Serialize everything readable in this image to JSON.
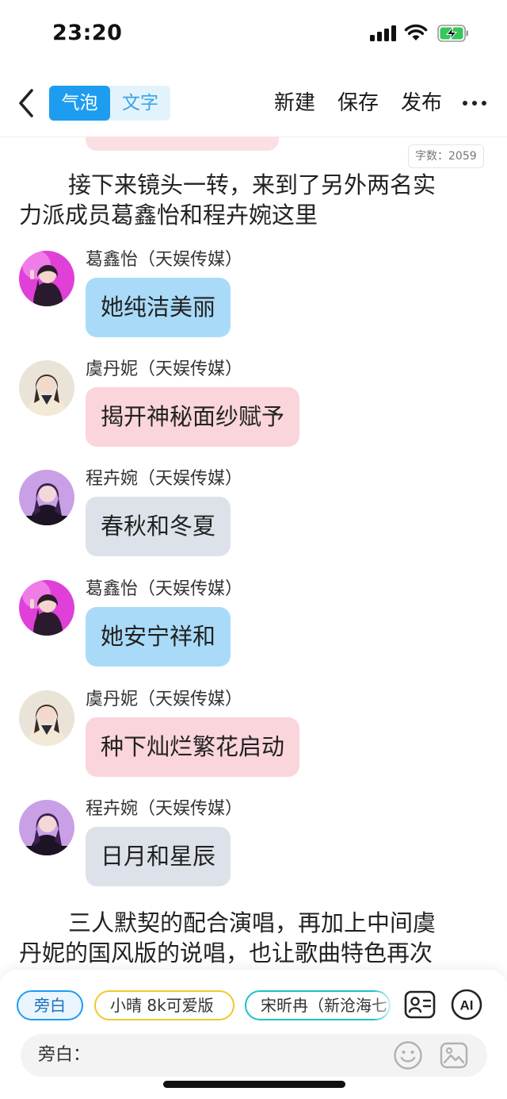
{
  "status_bar": {
    "time": "23:20"
  },
  "header": {
    "back_icon": "chevron-left-icon",
    "segment": {
      "bubble_label": "气泡",
      "text_label": "文字",
      "selected": "气泡"
    },
    "new_label": "新建",
    "save_label": "保存",
    "publish_label": "发布",
    "more_icon": "more-horizontal-icon"
  },
  "word_count": "字数：2059",
  "narration_1": {
    "line1": "接下来镜头一转，来到了另外两名实",
    "line2": "力派成员葛鑫怡和程卉婉这里"
  },
  "messages": [
    {
      "name": "葛鑫怡（天娱传媒）",
      "text": "她纯洁美丽",
      "color": "#a9dbf8"
    },
    {
      "name": "虞丹妮（天娱传媒）",
      "text": "揭开神秘面纱赋予",
      "color": "#fad5db"
    },
    {
      "name": "程卉婉（天娱传媒）",
      "text": "春秋和冬夏",
      "color": "#dde2ea"
    },
    {
      "name": "葛鑫怡（天娱传媒）",
      "text": "她安宁祥和",
      "color": "#a9dbf8"
    },
    {
      "name": "虞丹妮（天娱传媒）",
      "text": "种下灿烂繁花启动",
      "color": "#fad5db"
    },
    {
      "name": "程卉婉（天娱传媒）",
      "text": "日月和星辰",
      "color": "#dde2ea"
    }
  ],
  "narration_2": {
    "line1": "三人默契的配合演唱，再加上中间虞",
    "line2": "丹妮的国风版的说唱，也让歌曲特色再次"
  },
  "bottom": {
    "chips": [
      "旁白",
      "小晴 8k可爱版",
      "宋昕冉（新沧海七"
    ],
    "contact_icon": "contact-card-icon",
    "ai_label": "AI",
    "input_label": "旁白：",
    "emoji_icon": "smiley-icon",
    "image_icon": "image-icon"
  }
}
